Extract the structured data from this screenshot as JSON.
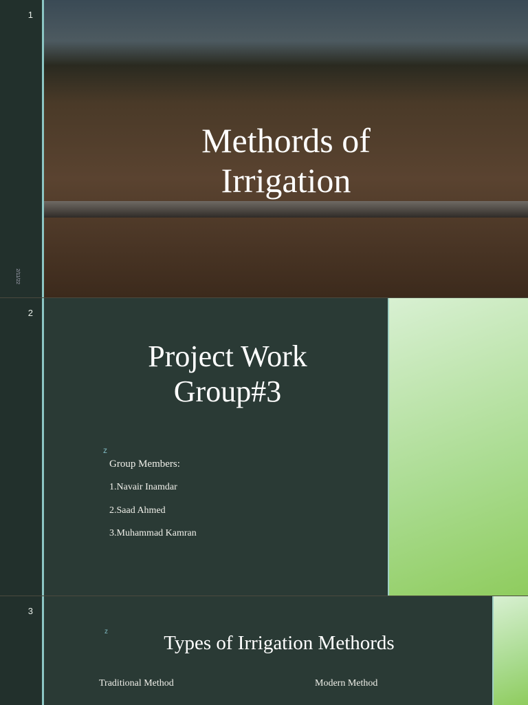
{
  "slides": [
    {
      "number": "1",
      "title_line1": "Methords of",
      "title_line2": "Irrigation",
      "date": "2/11/22"
    },
    {
      "number": "2",
      "title_line1": "Project Work",
      "title_line2": "Group#3",
      "marker": "z",
      "members_heading": "Group Members:",
      "members": [
        "1.Navair Inamdar",
        "2.Saad Ahmed",
        "3.Muhammad Kamran"
      ]
    },
    {
      "number": "3",
      "marker": "z",
      "title": "Types of Irrigation Methords",
      "left_heading": "Traditional Method",
      "right_heading": "Modern Method"
    }
  ]
}
